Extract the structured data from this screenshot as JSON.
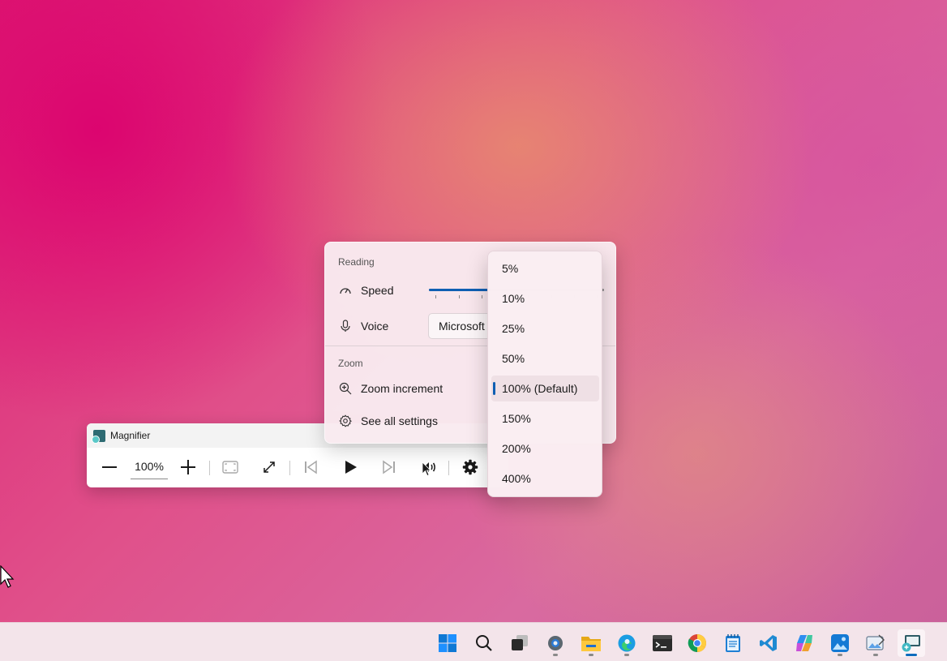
{
  "magnifier": {
    "title": "Magnifier",
    "zoom_level": "100%",
    "buttons": [
      "zoom-out",
      "zoom-in",
      "lens-view",
      "full-screen",
      "read-from-previous",
      "play",
      "read-from-next",
      "reading-mode",
      "settings"
    ]
  },
  "flyout": {
    "reading_header": "Reading",
    "speed_label": "Speed",
    "speed_value": 0.35,
    "voice_label": "Voice",
    "voice_value": "Microsoft",
    "zoom_header": "Zoom",
    "zoom_increment_label": "Zoom increment",
    "see_all_label": "See all settings"
  },
  "zoom_increment_options": {
    "items": [
      "5%",
      "10%",
      "25%",
      "50%",
      "100% (Default)",
      "150%",
      "200%",
      "400%"
    ],
    "selected": "100% (Default)"
  },
  "taskbar": {
    "apps": [
      "start",
      "search",
      "task-view",
      "settings",
      "file-explorer",
      "edge",
      "terminal",
      "chrome",
      "notepad",
      "vscode",
      "copilot",
      "photos",
      "paint",
      "magnifier"
    ],
    "active": "magnifier"
  },
  "colors": {
    "accent": "#0f5fb3",
    "background_pink": "#dd1d72",
    "background_peach": "#e88c6e"
  }
}
